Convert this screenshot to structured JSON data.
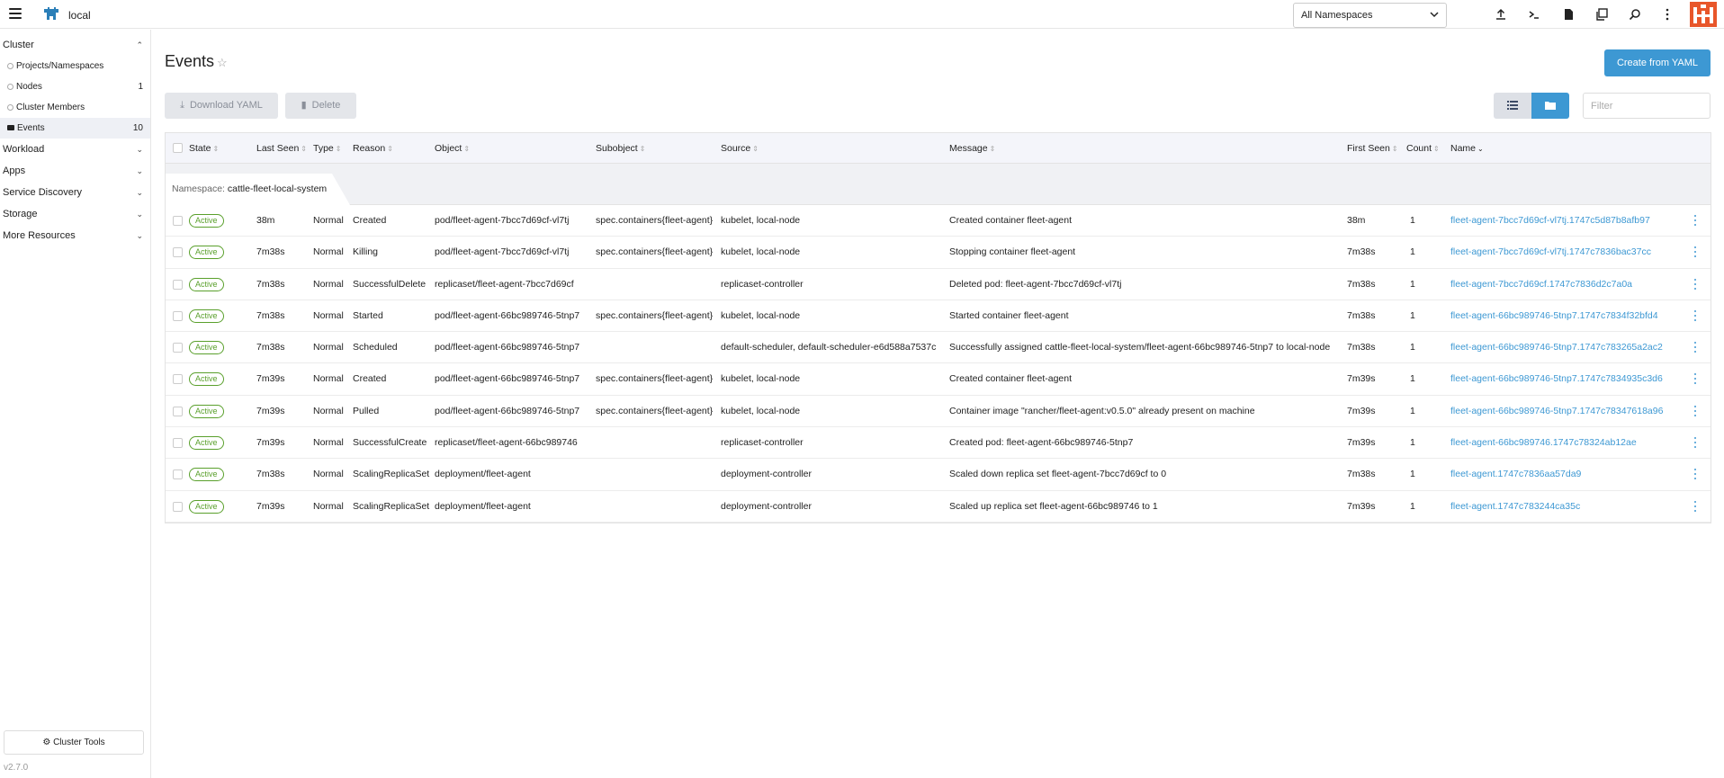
{
  "header": {
    "cluster_name": "local",
    "namespace_select": "All Namespaces",
    "icons": [
      "import-yaml-icon",
      "kubectl-shell-icon",
      "kubeconfig-download-icon",
      "copy-kubeconfig-icon",
      "search-icon",
      "more-options-icon"
    ]
  },
  "sidebar": {
    "cluster_label": "Cluster",
    "items": [
      {
        "label": "Projects/Namespaces",
        "count": ""
      },
      {
        "label": "Nodes",
        "count": "1"
      },
      {
        "label": "Cluster Members",
        "count": ""
      },
      {
        "label": "Events",
        "count": "10"
      }
    ],
    "groups": [
      "Workload",
      "Apps",
      "Service Discovery",
      "Storage",
      "More Resources"
    ],
    "cluster_tools": "Cluster Tools",
    "version": "v2.7.0"
  },
  "page": {
    "title": "Events",
    "create_button": "Create from YAML",
    "download_button": "Download YAML",
    "delete_button": "Delete",
    "filter_placeholder": "Filter"
  },
  "table": {
    "columns": [
      "State",
      "Last Seen",
      "Type",
      "Reason",
      "Object",
      "Subobject",
      "Source",
      "Message",
      "First Seen",
      "Count",
      "Name"
    ],
    "group_label": "Namespace:",
    "group_value": "cattle-fleet-local-system",
    "rows": [
      {
        "state": "Active",
        "last_seen": "38m",
        "type": "Normal",
        "reason": "Created",
        "object": "pod/fleet-agent-7bcc7d69cf-vl7tj",
        "subobject": "spec.containers{fleet-agent}",
        "source": "kubelet, local-node",
        "message": "Created container fleet-agent",
        "first_seen": "38m",
        "count": "1",
        "name": "fleet-agent-7bcc7d69cf-vl7tj.1747c5d87b8afb97"
      },
      {
        "state": "Active",
        "last_seen": "7m38s",
        "type": "Normal",
        "reason": "Killing",
        "object": "pod/fleet-agent-7bcc7d69cf-vl7tj",
        "subobject": "spec.containers{fleet-agent}",
        "source": "kubelet, local-node",
        "message": "Stopping container fleet-agent",
        "first_seen": "7m38s",
        "count": "1",
        "name": "fleet-agent-7bcc7d69cf-vl7tj.1747c7836bac37cc"
      },
      {
        "state": "Active",
        "last_seen": "7m38s",
        "type": "Normal",
        "reason": "SuccessfulDelete",
        "object": "replicaset/fleet-agent-7bcc7d69cf",
        "subobject": "",
        "source": "replicaset-controller",
        "message": "Deleted pod: fleet-agent-7bcc7d69cf-vl7tj",
        "first_seen": "7m38s",
        "count": "1",
        "name": "fleet-agent-7bcc7d69cf.1747c7836d2c7a0a"
      },
      {
        "state": "Active",
        "last_seen": "7m38s",
        "type": "Normal",
        "reason": "Started",
        "object": "pod/fleet-agent-66bc989746-5tnp7",
        "subobject": "spec.containers{fleet-agent}",
        "source": "kubelet, local-node",
        "message": "Started container fleet-agent",
        "first_seen": "7m38s",
        "count": "1",
        "name": "fleet-agent-66bc989746-5tnp7.1747c7834f32bfd4"
      },
      {
        "state": "Active",
        "last_seen": "7m38s",
        "type": "Normal",
        "reason": "Scheduled",
        "object": "pod/fleet-agent-66bc989746-5tnp7",
        "subobject": "",
        "source": "default-scheduler, default-scheduler-e6d588a7537c",
        "message": "Successfully assigned cattle-fleet-local-system/fleet-agent-66bc989746-5tnp7 to local-node",
        "first_seen": "7m38s",
        "count": "1",
        "name": "fleet-agent-66bc989746-5tnp7.1747c783265a2ac2"
      },
      {
        "state": "Active",
        "last_seen": "7m39s",
        "type": "Normal",
        "reason": "Created",
        "object": "pod/fleet-agent-66bc989746-5tnp7",
        "subobject": "spec.containers{fleet-agent}",
        "source": "kubelet, local-node",
        "message": "Created container fleet-agent",
        "first_seen": "7m39s",
        "count": "1",
        "name": "fleet-agent-66bc989746-5tnp7.1747c7834935c3d6"
      },
      {
        "state": "Active",
        "last_seen": "7m39s",
        "type": "Normal",
        "reason": "Pulled",
        "object": "pod/fleet-agent-66bc989746-5tnp7",
        "subobject": "spec.containers{fleet-agent}",
        "source": "kubelet, local-node",
        "message": "Container image \"rancher/fleet-agent:v0.5.0\" already present on machine",
        "first_seen": "7m39s",
        "count": "1",
        "name": "fleet-agent-66bc989746-5tnp7.1747c78347618a96"
      },
      {
        "state": "Active",
        "last_seen": "7m39s",
        "type": "Normal",
        "reason": "SuccessfulCreate",
        "object": "replicaset/fleet-agent-66bc989746",
        "subobject": "",
        "source": "replicaset-controller",
        "message": "Created pod: fleet-agent-66bc989746-5tnp7",
        "first_seen": "7m39s",
        "count": "1",
        "name": "fleet-agent-66bc989746.1747c78324ab12ae"
      },
      {
        "state": "Active",
        "last_seen": "7m38s",
        "type": "Normal",
        "reason": "ScalingReplicaSet",
        "object": "deployment/fleet-agent",
        "subobject": "",
        "source": "deployment-controller",
        "message": "Scaled down replica set fleet-agent-7bcc7d69cf to 0",
        "first_seen": "7m38s",
        "count": "1",
        "name": "fleet-agent.1747c7836aa57da9"
      },
      {
        "state": "Active",
        "last_seen": "7m39s",
        "type": "Normal",
        "reason": "ScalingReplicaSet",
        "object": "deployment/fleet-agent",
        "subobject": "",
        "source": "deployment-controller",
        "message": "Scaled up replica set fleet-agent-66bc989746 to 1",
        "first_seen": "7m39s",
        "count": "1",
        "name": "fleet-agent.1747c783244ca35c"
      }
    ]
  },
  "colors": {
    "primary": "#3d98d3",
    "active_badge": "#5aa02c",
    "brand": "#e8562a"
  }
}
